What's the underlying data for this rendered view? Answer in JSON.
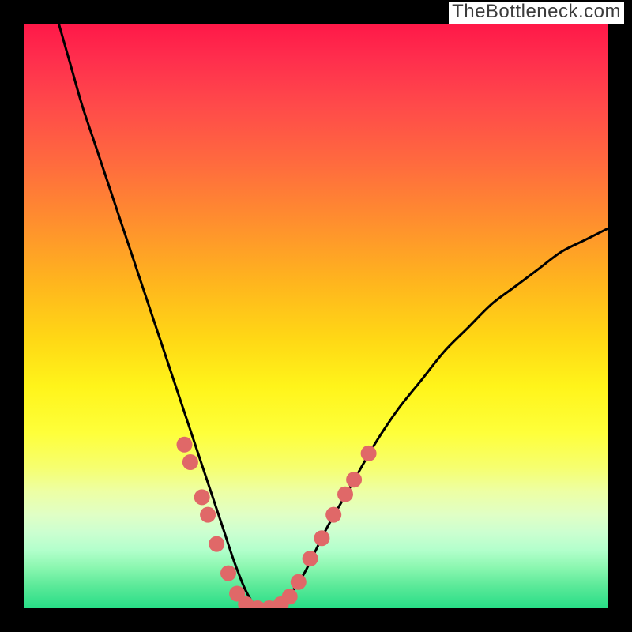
{
  "watermark": "TheBottleneck.com",
  "chart_data": {
    "type": "line",
    "title": "",
    "xlabel": "",
    "ylabel": "",
    "xlim": [
      0,
      100
    ],
    "ylim": [
      0,
      100
    ],
    "grid": false,
    "legend": false,
    "comment": "V-shaped bottleneck curve. Y represents bottleneck severity (100=red/top, 0=green/bottom). Curve reaches 0 near x≈40.",
    "series": [
      {
        "name": "bottleneck-curve",
        "color": "#000000",
        "x": [
          6,
          8,
          10,
          12,
          14,
          16,
          18,
          20,
          22,
          24,
          26,
          28,
          30,
          32,
          34,
          36,
          38,
          40,
          42,
          44,
          46,
          48,
          50,
          52,
          56,
          60,
          64,
          68,
          72,
          76,
          80,
          84,
          88,
          92,
          96,
          100
        ],
        "y": [
          100,
          93,
          86,
          80,
          74,
          68,
          62,
          56,
          50,
          44,
          38,
          32,
          26,
          20,
          14,
          8,
          3,
          0,
          0,
          1,
          3,
          6,
          10,
          14,
          21,
          28,
          34,
          39,
          44,
          48,
          52,
          55,
          58,
          61,
          63,
          65
        ]
      }
    ],
    "markers": [
      {
        "name": "salmon-dots",
        "color": "#e06868",
        "radius": 10,
        "points": [
          {
            "x": 27.5,
            "y": 28
          },
          {
            "x": 28.5,
            "y": 25
          },
          {
            "x": 30.5,
            "y": 19
          },
          {
            "x": 31.5,
            "y": 16
          },
          {
            "x": 33.0,
            "y": 11
          },
          {
            "x": 35.0,
            "y": 6
          },
          {
            "x": 36.5,
            "y": 2.5
          },
          {
            "x": 38.0,
            "y": 0.7
          },
          {
            "x": 40.0,
            "y": 0
          },
          {
            "x": 42.0,
            "y": 0
          },
          {
            "x": 44.0,
            "y": 0.7
          },
          {
            "x": 45.5,
            "y": 2.0
          },
          {
            "x": 47.0,
            "y": 4.5
          },
          {
            "x": 49.0,
            "y": 8.5
          },
          {
            "x": 51.0,
            "y": 12
          },
          {
            "x": 53.0,
            "y": 16
          },
          {
            "x": 55.0,
            "y": 19.5
          },
          {
            "x": 56.5,
            "y": 22
          },
          {
            "x": 59.0,
            "y": 26.5
          }
        ]
      }
    ]
  }
}
